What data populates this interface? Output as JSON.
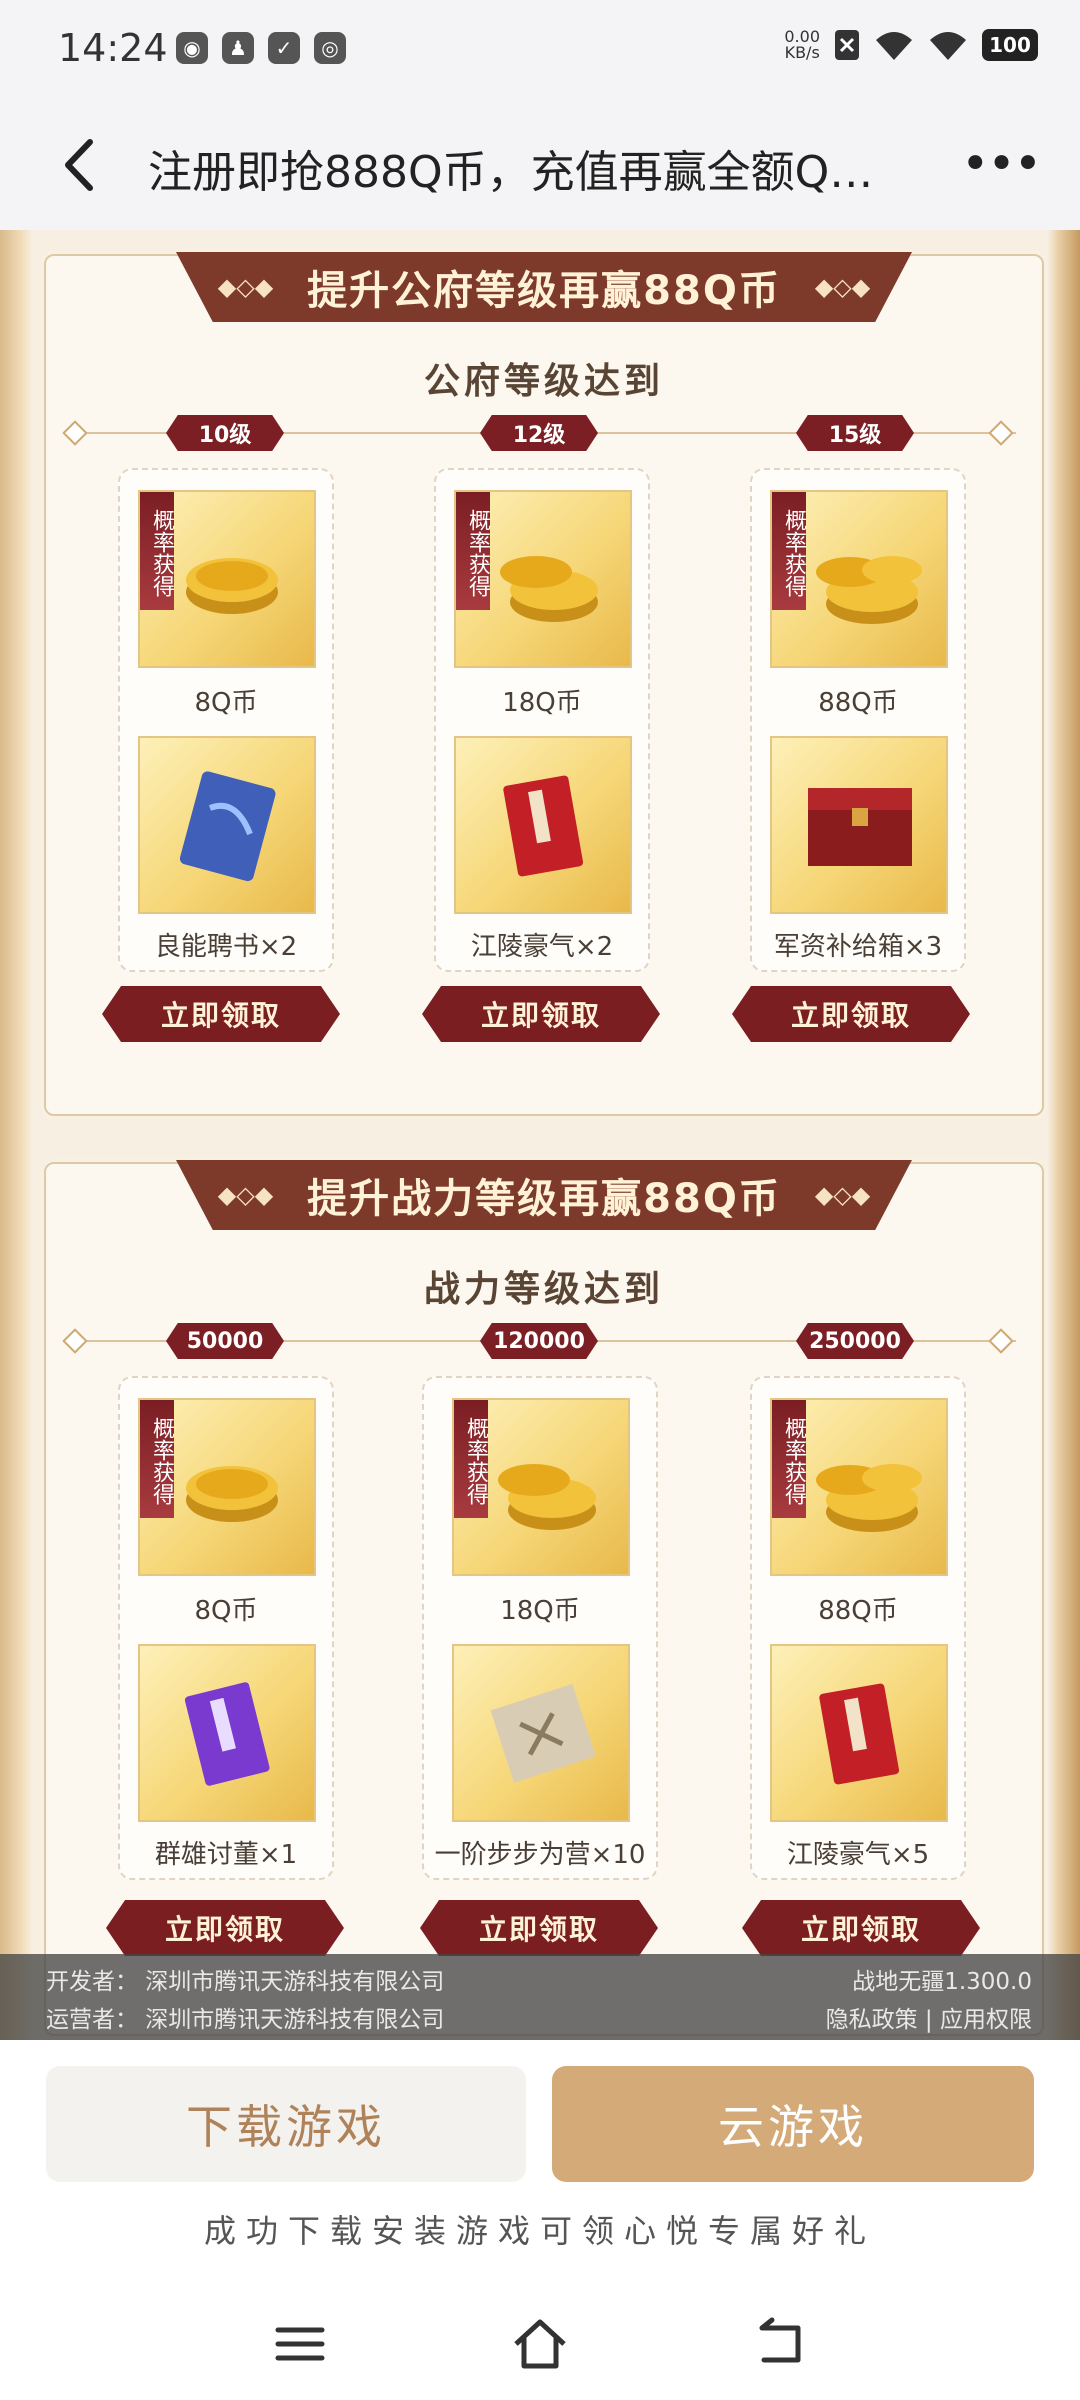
{
  "status_bar": {
    "time": "14:24",
    "net_speed_value": "0.00",
    "net_speed_unit": "KB/s",
    "battery": "100"
  },
  "header": {
    "title": "注册即抢888Q币，充值再赢全额Q…"
  },
  "sections": [
    {
      "banner": "提升公府等级再赢88Q币",
      "subtitle": "公府等级达到",
      "tiers": [
        {
          "level": "10级",
          "tag": "概率获得",
          "reward1": "8Q币",
          "reward2": "良能聘书×2",
          "claim": "立即领取"
        },
        {
          "level": "12级",
          "tag": "概率获得",
          "reward1": "18Q币",
          "reward2": "江陵豪气×2",
          "claim": "立即领取"
        },
        {
          "level": "15级",
          "tag": "概率获得",
          "reward1": "88Q币",
          "reward2": "军资补给箱×3",
          "claim": "立即领取"
        }
      ]
    },
    {
      "banner": "提升战力等级再赢88Q币",
      "subtitle": "战力等级达到",
      "tiers": [
        {
          "level": "50000",
          "tag": "概率获得",
          "reward1": "8Q币",
          "reward2": "群雄讨董×1",
          "claim": "立即领取"
        },
        {
          "level": "120000",
          "tag": "概率获得",
          "reward1": "18Q币",
          "reward2": "一阶步步为营×10",
          "claim": "立即领取"
        },
        {
          "level": "250000",
          "tag": "概率获得",
          "reward1": "88Q币",
          "reward2": "江陵豪气×5",
          "claim": "立即领取"
        }
      ]
    }
  ],
  "footer_info": {
    "developer": "开发者：  深圳市腾讯天游科技有限公司",
    "operator": "运营者：  深圳市腾讯天游科技有限公司",
    "game_version": "战地无疆1.300.0",
    "links": "隐私政策 | 应用权限"
  },
  "actions": {
    "download": "下载游戏",
    "cloud": "云游戏",
    "hint": "成功下载安装游戏可领心悦专属好礼"
  },
  "colors": {
    "banner": "#7d3a2b",
    "claim_button": "#7a1e22",
    "cloud_button": "#d4aa79"
  }
}
